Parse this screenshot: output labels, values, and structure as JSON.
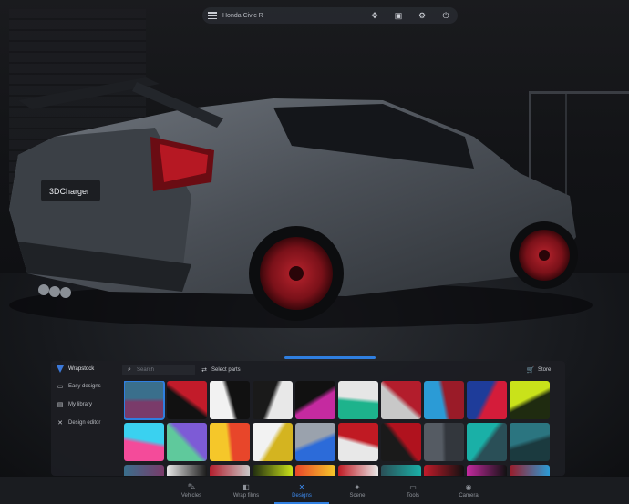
{
  "topbar": {
    "title": "Honda Civic R",
    "icons": [
      "menu-icon",
      "move-icon",
      "save-icon",
      "settings-icon",
      "power-icon"
    ]
  },
  "car": {
    "badge": "3DCharger"
  },
  "panel": {
    "brand": "Wrapstock",
    "sidebar": [
      {
        "label": "Easy designs",
        "icon": "layers-icon"
      },
      {
        "label": "My library",
        "icon": "library-icon"
      },
      {
        "label": "Design editor",
        "icon": "wrench-icon"
      }
    ],
    "search_placeholder": "Search",
    "select_parts": "Select parts",
    "store": "Store"
  },
  "tiles": [
    {
      "colors": [
        "#7a3b6a",
        "#3a6f8c"
      ]
    },
    {
      "colors": [
        "#111111",
        "#c21b2a"
      ]
    },
    {
      "colors": [
        "#f2f2f2",
        "#111111"
      ]
    },
    {
      "colors": [
        "#1a1a1a",
        "#e8e8e8"
      ]
    },
    {
      "colors": [
        "#111111",
        "#c52aa0"
      ]
    },
    {
      "colors": [
        "#1db38c",
        "#e6e6e6"
      ]
    },
    {
      "colors": [
        "#c8c8c8",
        "#b31d2c"
      ]
    },
    {
      "colors": [
        "#2b9bd6",
        "#9a1b28"
      ]
    },
    {
      "colors": [
        "#1e3c9a",
        "#d41c3a"
      ]
    },
    {
      "colors": [
        "#c9e21a",
        "#1f2b10"
      ]
    },
    {
      "colors": [
        "#f44b9a",
        "#3ad1f0"
      ]
    },
    {
      "colors": [
        "#5fc99c",
        "#7d5bd6"
      ]
    },
    {
      "colors": [
        "#f5c72a",
        "#e8462a"
      ]
    },
    {
      "colors": [
        "#f2f2f2",
        "#d4b420"
      ]
    },
    {
      "colors": [
        "#9aa2ad",
        "#2c6bd9"
      ]
    },
    {
      "colors": [
        "#e8e8e8",
        "#c01a23"
      ]
    },
    {
      "colors": [
        "#1a1a1a",
        "#b0121e"
      ]
    },
    {
      "colors": [
        "#555b63",
        "#33373d"
      ]
    },
    {
      "colors": [
        "#1ab0a7",
        "#2a4f57"
      ]
    },
    {
      "colors": [
        "#2b7580",
        "#1b3a3f"
      ]
    }
  ],
  "nav": [
    {
      "label": "Vehicles",
      "icon": "car-icon",
      "active": false
    },
    {
      "label": "Wrap films",
      "icon": "film-icon",
      "active": false
    },
    {
      "label": "Designs",
      "icon": "designs-icon",
      "active": true
    },
    {
      "label": "Scene",
      "icon": "scene-icon",
      "active": false
    },
    {
      "label": "Tools",
      "icon": "tools-icon",
      "active": false
    },
    {
      "label": "Camera",
      "icon": "camera-icon",
      "active": false
    }
  ]
}
